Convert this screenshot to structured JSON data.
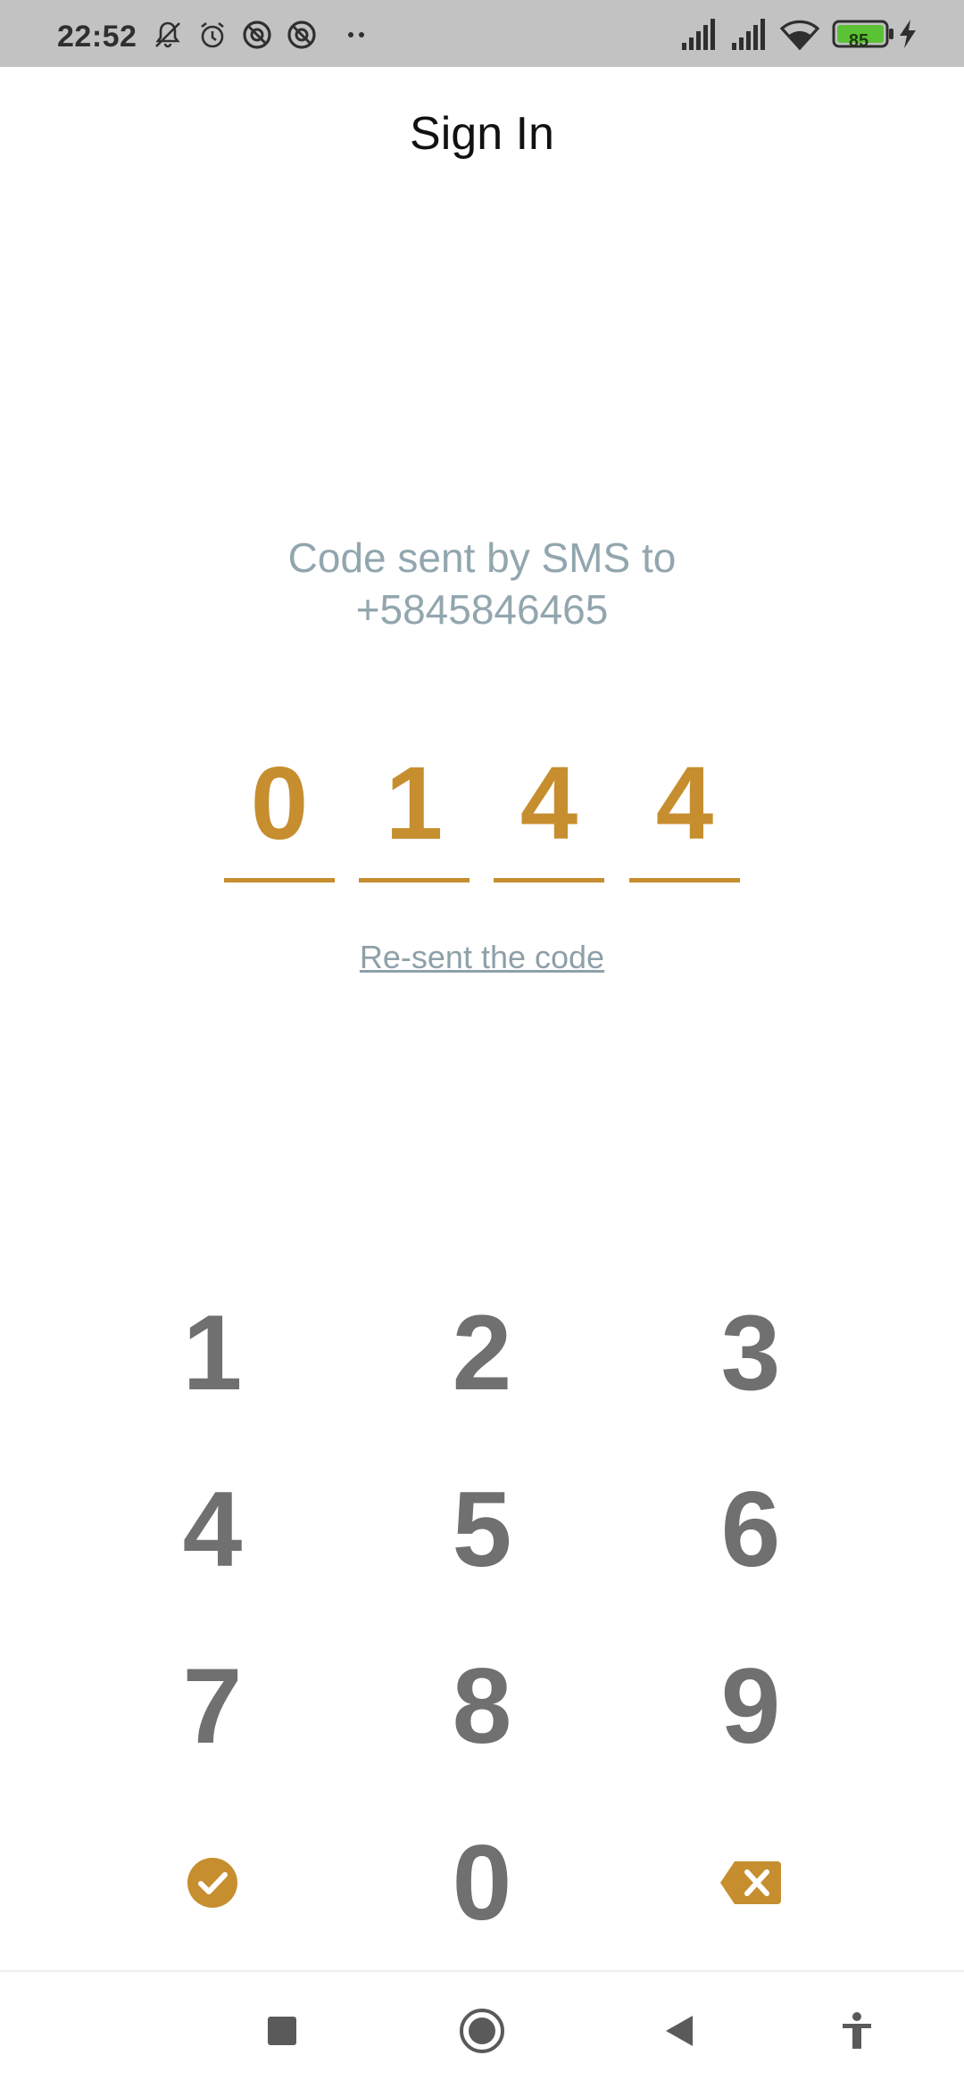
{
  "status_bar": {
    "time": "22:52",
    "battery_level": "85",
    "icons": [
      "mute-bell-icon",
      "alarm-icon",
      "blocked-icon",
      "blocked-icon",
      "more-dots-icon",
      "signal-icon",
      "signal-icon",
      "wifi-icon",
      "battery-icon",
      "charging-icon"
    ]
  },
  "header": {
    "title": "Sign In"
  },
  "verification": {
    "message_line1": "Code sent by SMS to",
    "message_line2": "+5845846465",
    "code_digits": [
      "0",
      "1",
      "4",
      "4"
    ],
    "resend_label": "Re-sent the code"
  },
  "keypad": {
    "keys": [
      "1",
      "2",
      "3",
      "4",
      "5",
      "6",
      "7",
      "8",
      "9",
      "0"
    ],
    "confirm_icon": "check-circle-icon",
    "delete_icon": "backspace-icon"
  },
  "nav_bar": {
    "buttons": [
      "recents-square-icon",
      "home-circle-icon",
      "back-triangle-icon",
      "accessibility-icon"
    ]
  },
  "colors": {
    "accent": "#c68e2f",
    "message_text": "#92a6ae",
    "key_text": "#707070",
    "status_bar_bg": "#c2c2c2"
  }
}
